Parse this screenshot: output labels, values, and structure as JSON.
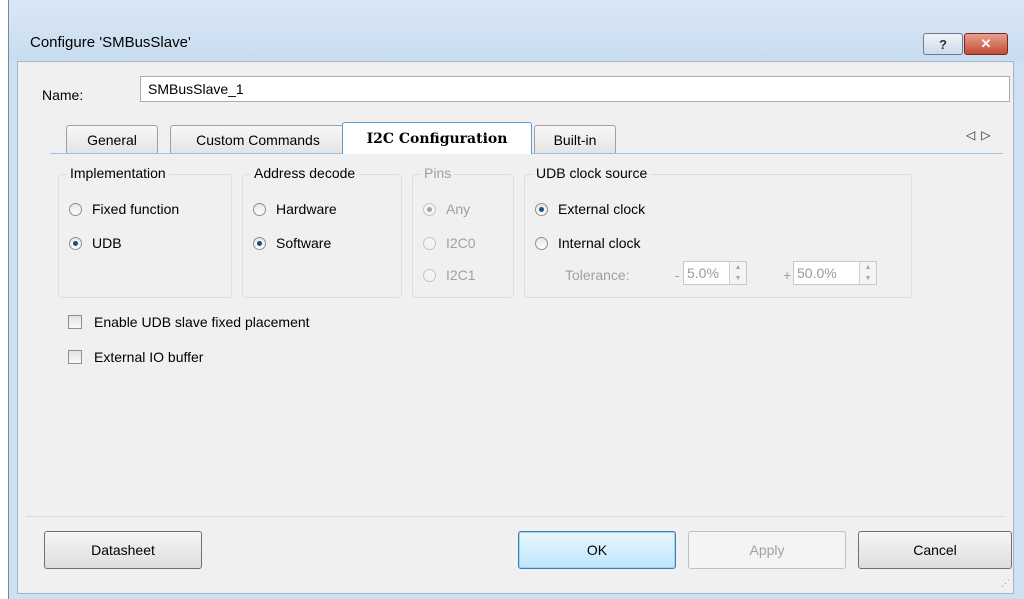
{
  "window": {
    "title": "Configure 'SMBusSlave'",
    "help_glyph": "?",
    "close_glyph": "✕"
  },
  "name_field": {
    "label": "Name:",
    "value": "SMBusSlave_1"
  },
  "tabs": [
    {
      "label": "General",
      "active": false
    },
    {
      "label": "Custom Commands",
      "active": false
    },
    {
      "label": "I2C Configuration",
      "active": true
    },
    {
      "label": "Built-in",
      "active": false
    }
  ],
  "tab_scroll": {
    "left": "◁",
    "right": "▷"
  },
  "groups": {
    "implementation": {
      "title": "Implementation",
      "options": [
        {
          "label": "Fixed function",
          "selected": false
        },
        {
          "label": "UDB",
          "selected": true
        }
      ]
    },
    "address_decode": {
      "title": "Address decode",
      "options": [
        {
          "label": "Hardware",
          "selected": false
        },
        {
          "label": "Software",
          "selected": true
        }
      ]
    },
    "pins": {
      "title": "Pins",
      "enabled": false,
      "options": [
        {
          "label": "Any",
          "selected": true
        },
        {
          "label": "I2C0",
          "selected": false
        },
        {
          "label": "I2C1",
          "selected": false
        }
      ]
    },
    "udb_clock": {
      "title": "UDB clock source",
      "options": [
        {
          "label": "External clock",
          "selected": true
        },
        {
          "label": "Internal clock",
          "selected": false
        }
      ],
      "tolerance_label": "Tolerance:",
      "minus_sign": "-",
      "minus_value": "5.0%",
      "plus_sign": "+",
      "plus_value": "50.0%"
    }
  },
  "checkboxes": [
    {
      "label": "Enable UDB slave fixed placement",
      "checked": false
    },
    {
      "label": "External IO buffer",
      "checked": false
    }
  ],
  "buttons": {
    "datasheet": "Datasheet",
    "ok": "OK",
    "apply": "Apply",
    "cancel": "Cancel"
  }
}
